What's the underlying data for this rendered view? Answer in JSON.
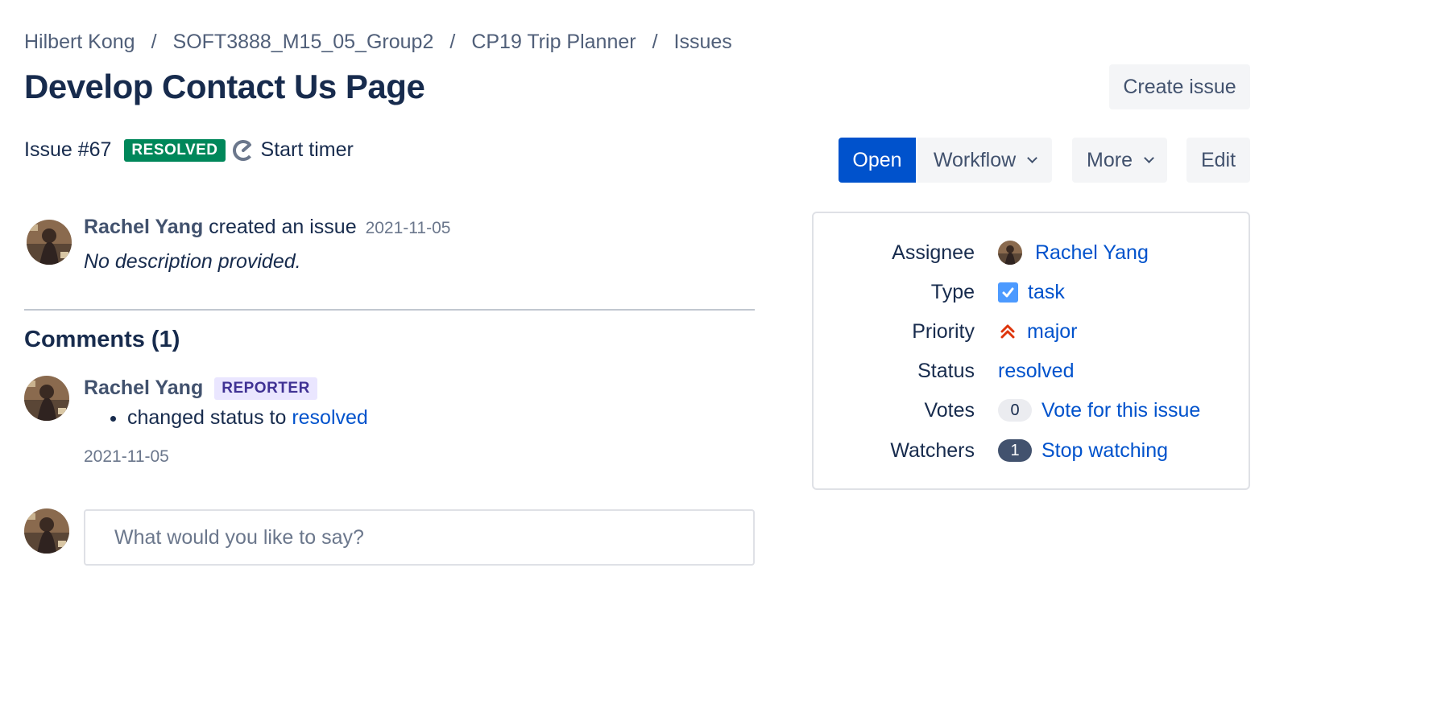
{
  "breadcrumb": {
    "items": [
      "Hilbert Kong",
      "SOFT3888_M15_05_Group2",
      "CP19 Trip Planner",
      "Issues"
    ],
    "separator": "/"
  },
  "page": {
    "title": "Develop Contact Us Page"
  },
  "actions": {
    "create_issue": "Create issue",
    "open": "Open",
    "workflow": "Workflow",
    "more": "More",
    "edit": "Edit"
  },
  "issue": {
    "number": "Issue #67",
    "status_lozenge": "RESOLVED",
    "start_timer": "Start timer"
  },
  "activity": {
    "author": "Rachel Yang",
    "action": "created an issue",
    "date": "2021-11-05",
    "description": "No description provided."
  },
  "comments": {
    "heading": "Comments (1)",
    "items": [
      {
        "author": "Rachel Yang",
        "role_badge": "REPORTER",
        "change_text": "changed status to",
        "change_value": "resolved",
        "date": "2021-11-05"
      }
    ],
    "input_placeholder": "What would you like to say?"
  },
  "details": {
    "assignee": {
      "label": "Assignee",
      "value": "Rachel Yang"
    },
    "type": {
      "label": "Type",
      "value": "task",
      "icon": "checkbox-icon"
    },
    "priority": {
      "label": "Priority",
      "value": "major",
      "icon": "double-chevron-up-icon"
    },
    "status": {
      "label": "Status",
      "value": "resolved"
    },
    "votes": {
      "label": "Votes",
      "count": "0",
      "action": "Vote for this issue"
    },
    "watchers": {
      "label": "Watchers",
      "count": "1",
      "action": "Stop watching"
    }
  },
  "colors": {
    "primary": "#0052cc",
    "resolved_green": "#00875a",
    "reporter_purple": "#403294",
    "priority_red": "#de350b",
    "text": "#172b4d"
  }
}
